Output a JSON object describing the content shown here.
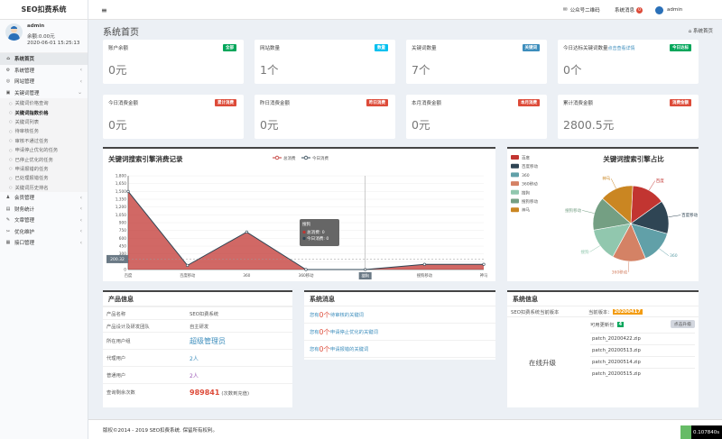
{
  "app": {
    "title": "SEO扣费系统"
  },
  "user": {
    "name": "admin",
    "balance": "余额:0.00元",
    "datetime": "2020-06-01 15:25:13"
  },
  "sidebar": {
    "top_items": [
      {
        "label": "系统首页",
        "icon": "home-icon",
        "glyph": "⌂",
        "active": true
      },
      {
        "label": "系统管理",
        "icon": "gear-icon",
        "glyph": "⚙",
        "arrow": "‹"
      },
      {
        "label": "网站管理",
        "icon": "globe-icon",
        "glyph": "◎",
        "arrow": "‹"
      },
      {
        "label": "关键词管理",
        "icon": "book-icon",
        "glyph": "▣",
        "arrow": "⌄"
      }
    ],
    "sub_items": [
      {
        "label": "关键词价格查询"
      },
      {
        "label": "关键词指数价格",
        "on": true
      },
      {
        "label": "关键词列表"
      },
      {
        "label": "待审核任务"
      },
      {
        "label": "审核不通过任务"
      },
      {
        "label": "申请停止优化的任务"
      },
      {
        "label": "已停止优化的任务"
      },
      {
        "label": "申请报错的任务"
      },
      {
        "label": "已处理报错任务"
      },
      {
        "label": "关键词历史排名"
      }
    ],
    "bottom_items": [
      {
        "label": "会员管理",
        "icon": "users-icon",
        "glyph": "♟",
        "arrow": "‹"
      },
      {
        "label": "财务统计",
        "icon": "money-icon",
        "glyph": "▤",
        "arrow": "‹"
      },
      {
        "label": "文章管理",
        "icon": "document-icon",
        "glyph": "✎",
        "arrow": "‹"
      },
      {
        "label": "优化维护",
        "icon": "wrench-icon",
        "glyph": "✂",
        "arrow": "‹"
      },
      {
        "label": "接口管理",
        "icon": "plug-icon",
        "glyph": "▦",
        "arrow": "‹"
      }
    ]
  },
  "topbar": {
    "menu_icon": "≡",
    "wechat_label": "公众号二维码",
    "messages_label": "系统消息",
    "messages_count": "0",
    "user_label": "admin"
  },
  "page": {
    "title": "系统首页",
    "breadcrumb": "系统首页"
  },
  "stats_row1": [
    {
      "label": "账户余额",
      "tag": "全部",
      "tag_color": "#00a65a",
      "value": "0元"
    },
    {
      "label": "网站数量",
      "tag": "数量",
      "tag_color": "#00c0ef",
      "value": "1个"
    },
    {
      "label": "关键词数量",
      "tag": "关键词",
      "tag_color": "#3c8dbc",
      "value": "7个"
    },
    {
      "label": "今日达标关键词数量",
      "link": "点击查看详情",
      "tag": "今日达标",
      "tag_color": "#00a65a",
      "value": "0个"
    }
  ],
  "stats_row2": [
    {
      "label": "今日消费金额",
      "tag": "累计消费",
      "tag_color": "#dd4b39",
      "value": "0元"
    },
    {
      "label": "昨日消费金额",
      "tag": "昨日消费",
      "tag_color": "#dd4b39",
      "value": "0元"
    },
    {
      "label": "本月消费金额",
      "tag": "本月消费",
      "tag_color": "#dd4b39",
      "value": "0元"
    },
    {
      "label": "累计消费金额",
      "tag": "消费金额",
      "tag_color": "#dd4b39",
      "value": "2800.5元"
    }
  ],
  "chart_data": [
    {
      "type": "area",
      "title": "关键词搜索引擎消费记录",
      "categories": [
        "百度",
        "百度移动",
        "360",
        "360移动",
        "搜狗",
        "搜狗移动",
        "神马"
      ],
      "series": [
        {
          "name": "总消费",
          "color": "#c23531",
          "values": [
            1500,
            80,
            720,
            0,
            0,
            100,
            100
          ]
        },
        {
          "name": "今日消费",
          "color": "#2f4554",
          "values": [
            0,
            0,
            0,
            0,
            0,
            0,
            0
          ]
        }
      ],
      "ylim": [
        0,
        1800
      ],
      "yticks": [
        0,
        150,
        300,
        450,
        600,
        750,
        900,
        1050,
        1200,
        1350,
        1500,
        1650,
        1800
      ],
      "tooltip": {
        "title": "搜狗",
        "lines": [
          "总消费: 0",
          "今日消费: 0"
        ]
      },
      "crosshair_value": "200.32",
      "crosshair_category": "搜狗"
    },
    {
      "type": "pie",
      "title": "关键词搜索引擎占比",
      "categories": [
        "百度",
        "百度移动",
        "360",
        "360移动",
        "搜狗",
        "搜狗移动",
        "神马"
      ],
      "colors": [
        "#c23531",
        "#2f4554",
        "#61a0a8",
        "#d48265",
        "#91c7ae",
        "#749f83",
        "#ca8622"
      ],
      "values": [
        1,
        1,
        1,
        1,
        1,
        1,
        1
      ]
    }
  ],
  "product": {
    "title": "产品信息",
    "rows": [
      {
        "k": "产品名称",
        "v": "SEO扣费系统",
        "cls": ""
      },
      {
        "k": "产品设计及研发团队",
        "v": "自主研发",
        "cls": ""
      },
      {
        "k": "所在用户组",
        "v": "超级管理员",
        "cls": "big"
      },
      {
        "k": "代理用户",
        "v": "2人",
        "cls": "blue"
      },
      {
        "k": "普通用户",
        "v": "2人",
        "cls": "purple"
      },
      {
        "k": "查询剩余次数",
        "v": "989841",
        "suffix": "(次数到充值)",
        "cls": "redbig"
      }
    ]
  },
  "messages": {
    "title": "系统消息",
    "items": [
      {
        "prefix": "您有",
        "count": "0个",
        "text": "待审核的关键词"
      },
      {
        "prefix": "您有",
        "count": "0个",
        "text": "申请停止优化的关键词"
      },
      {
        "prefix": "您有",
        "count": "0个",
        "text": "申请报错的关键词"
      }
    ]
  },
  "sysinfo": {
    "title": "系统信息",
    "version_label": "SEO扣费系统当前版本",
    "current_label": "当前版本：",
    "current_version": "20200417",
    "upgrade_label": "在线升级",
    "patch_title": "可用更新包",
    "patch_count": "4",
    "upgrade_button": "点击升级",
    "patches": [
      "patch_20200422.zip",
      "patch_20200513.zip",
      "patch_20200514.zip",
      "patch_20200515.zip"
    ]
  },
  "footer": {
    "text": "版权©2014 - 2019 SEO扣费系统. 保留所有权利。",
    "debug": "0.107840s"
  }
}
